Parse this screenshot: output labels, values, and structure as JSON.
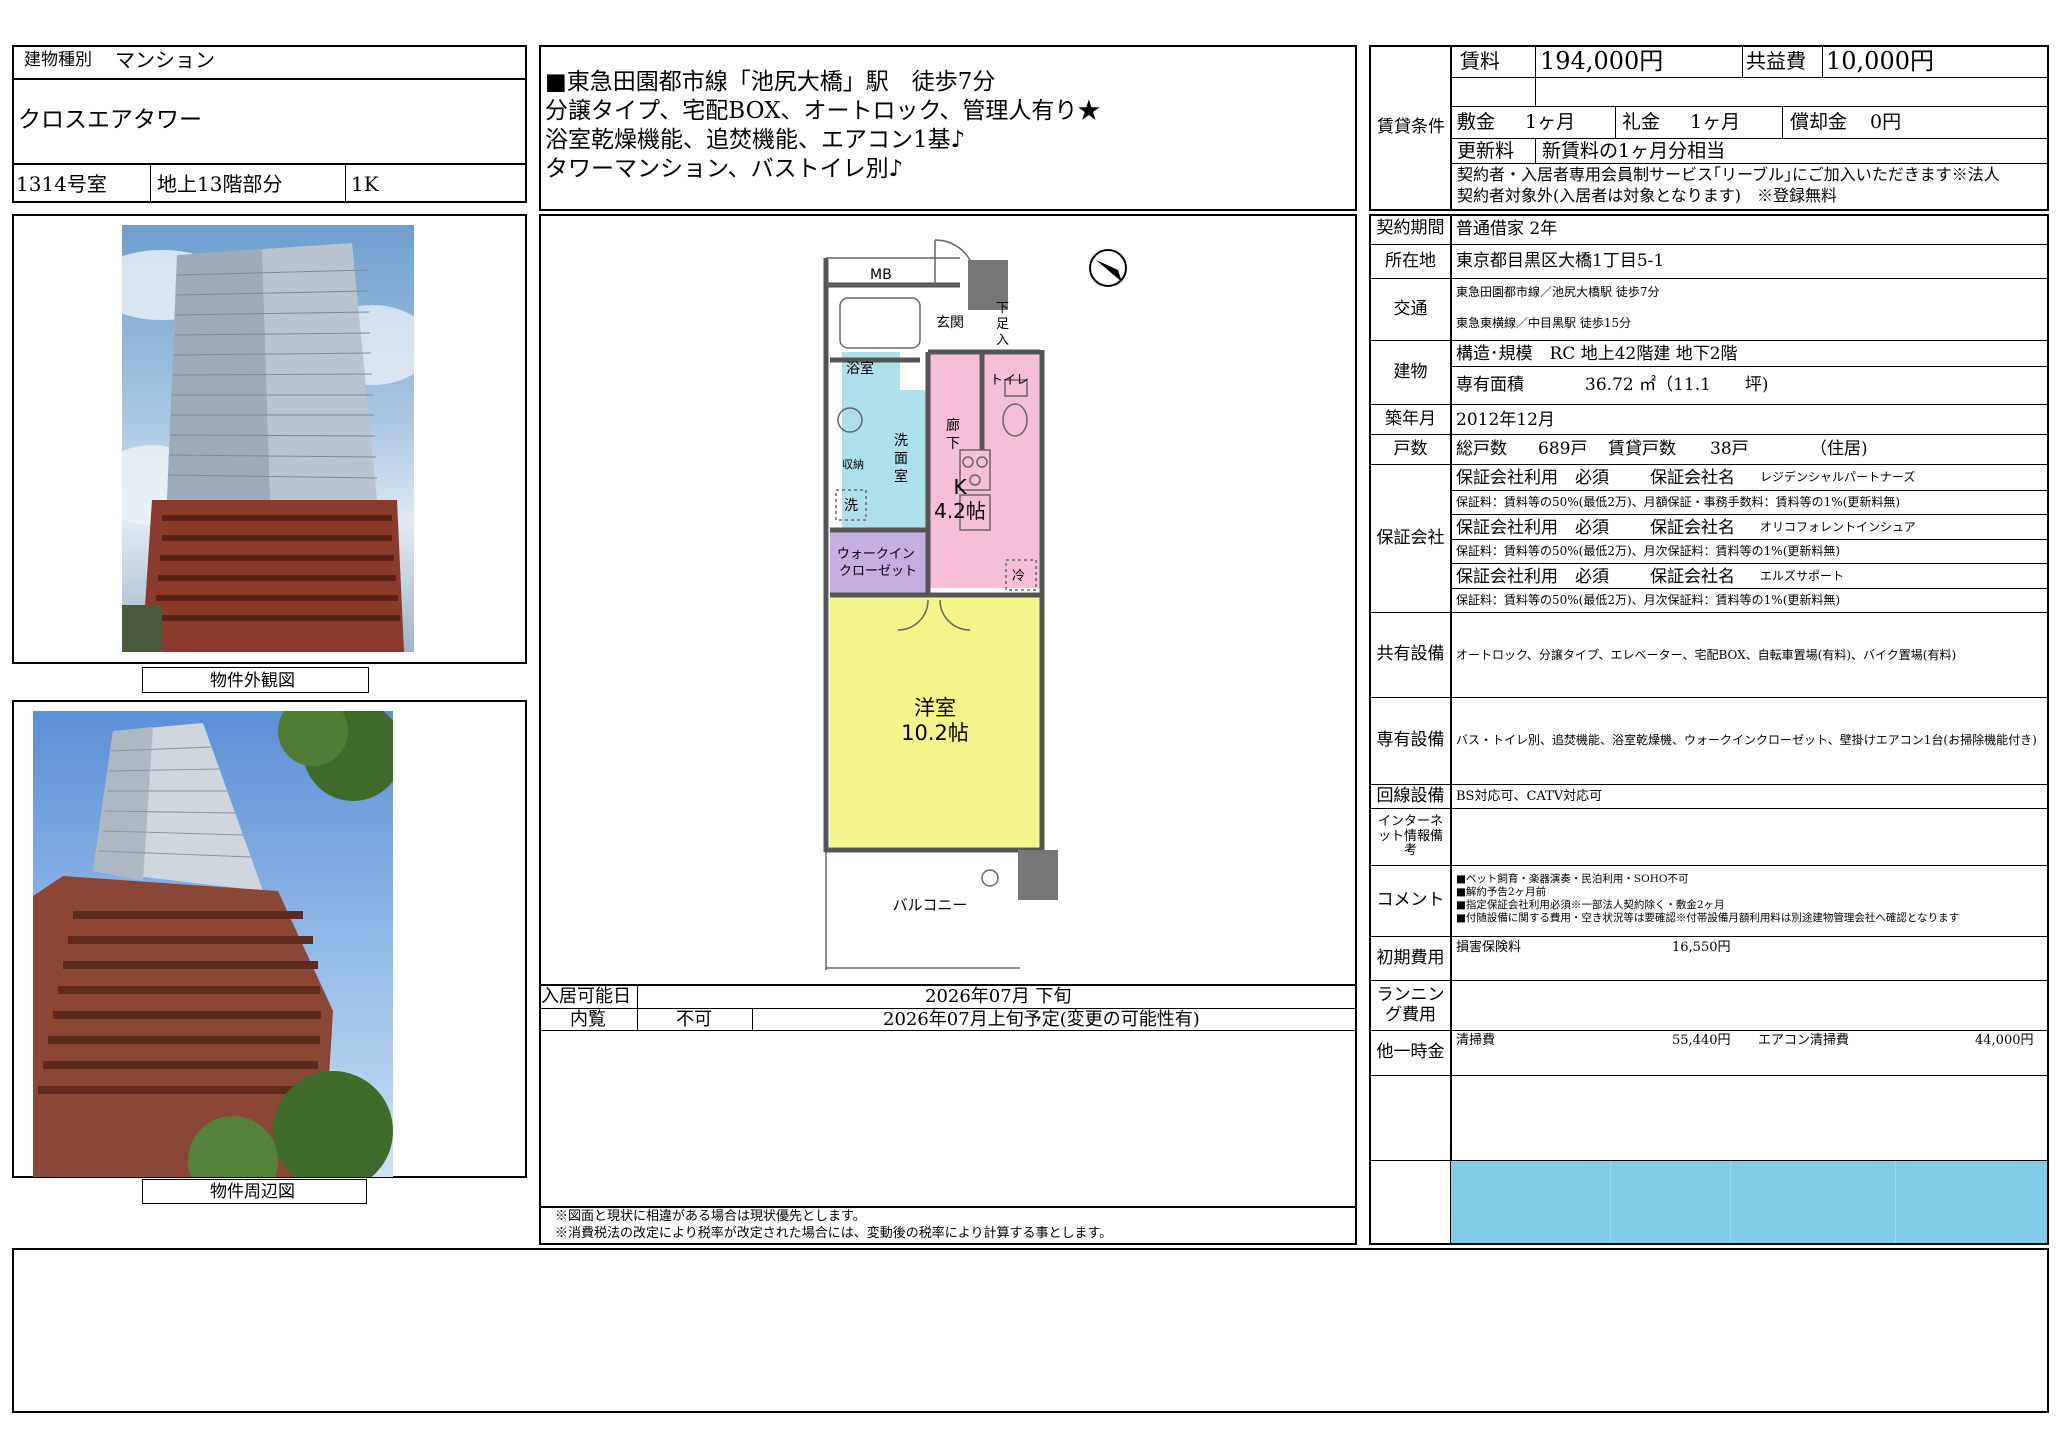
{
  "building": {
    "type_label": "建物種別",
    "type_value": "マンション",
    "name": "クロスエアタワー",
    "room": "1314号室",
    "floor": "地上13階部分",
    "layout": "1K"
  },
  "photos": {
    "exterior_caption": "物件外観図",
    "surroundings_caption": "物件周辺図"
  },
  "headline": [
    "■東急田園都市線「池尻大橋」駅　徒歩7分",
    "分譲タイプ、宅配BOX、オートロック、管理人有り★",
    "浴室乾燥機能、追焚機能、エアコン1基♪",
    "タワーマンション、バストイレ別♪"
  ],
  "floorplan": {
    "rooms": {
      "mb": "MB",
      "entrance": "玄関",
      "shoe_box": "下足入",
      "bath": "浴室",
      "toilet": "トイレ",
      "washroom": "洗面室",
      "corridor": "廊下",
      "storage": "収納",
      "washer": "洗",
      "kitchen": "K",
      "kitchen_size": "4.2帖",
      "wic": "ウォークイン\nクローゼット",
      "fridge": "冷",
      "western": "洋室",
      "western_size": "10.2帖",
      "balcony": "バルコニー"
    }
  },
  "availability": {
    "move_in_label": "入居可能日",
    "move_in_value": "2026年07月 下旬",
    "viewing_label": "内覧",
    "viewing_value": "不可",
    "viewing_note": "2026年07月上旬予定(変更の可能性有)"
  },
  "notes": [
    "※図面と現状に相違がある場合は現状優先とします。",
    "※消費税法の改定により税率が改定された場合には、変動後の税率により計算する事とします。"
  ],
  "conditions": {
    "section_label": "賃貸条件",
    "rent_label": "賃料",
    "rent_value": "194,000円",
    "common_label": "共益費",
    "common_value": "10,000円",
    "deposit_label": "敷金",
    "deposit_value": "1ヶ月",
    "key_money_label": "礼金",
    "key_money_value": "1ヶ月",
    "amort_label": "償却金",
    "amort_value": "0円",
    "renewal_label": "更新料",
    "renewal_value": "新賃料の1ヶ月分相当",
    "remark_1": "契約者・入居者専用会員制サービス｢リーブル｣にご加入いただきます※法人",
    "remark_2": "契約者対象外(入居者は対象となります)　※登録無料"
  },
  "details": {
    "contract_label": "契約期間",
    "contract_value": "普通借家 2年",
    "address_label": "所在地",
    "address_value": "東京都目黒区大橋1丁目5-1",
    "transport_label": "交通",
    "transport_1": "東急田園都市線／池尻大橋駅 徒歩7分",
    "transport_2": "東急東横線／中目黒駅 徒歩15分",
    "building_label": "建物",
    "structure": "構造･規模　RC 地上42階建 地下2階",
    "area_label": "専有面積",
    "area_value": "36.72 ㎡（11.1　　坪)",
    "built_label": "築年月",
    "built_value": "2012年12月",
    "units_label": "戸数",
    "units_total_label": "総戸数",
    "units_total": "689戸",
    "units_rent_label": "賃貸戸数",
    "units_rent": "38戸",
    "units_note": "（住居)",
    "guarantee_label": "保証会社",
    "guarantors": [
      {
        "use": "保証会社利用　必須",
        "name_label": "保証会社名",
        "name": "レジデンシャルパートナーズ",
        "fee": "保証料：賃料等の50%(最低2万)、月額保証・事務手数料：賃料等の1%(更新料無)"
      },
      {
        "use": "保証会社利用　必須",
        "name_label": "保証会社名",
        "name": "オリコフォレントインシュア",
        "fee": "保証料：賃料等の50%(最低2万)、月次保証料：賃料等の1%(更新料無)"
      },
      {
        "use": "保証会社利用　必須",
        "name_label": "保証会社名",
        "name": "エルズサポート",
        "fee": "保証料：賃料等の50%(最低2万)、月次保証料：賃料等の1%(更新料無)"
      }
    ],
    "shared_label": "共有設備",
    "shared_value": "オートロック、分譲タイプ、エレベーター、宅配BOX、自転車置場(有料)、バイク置場(有料)",
    "private_label": "専有設備",
    "private_value": "バス・トイレ別、追焚機能、浴室乾燥機、ウォークインクローゼット、壁掛けエアコン1台(お掃除機能付き)",
    "line_label": "回線設備",
    "line_value": "BS対応可、CATV対応可",
    "internet_label": "インターネット情報備考",
    "comment_label": "コメント",
    "comments": [
      "■ペット飼育・楽器演奏・民泊利用・SOHO不可",
      "■解約予告2ヶ月前",
      "■指定保証会社利用必須※一部法人契約除く・敷金2ヶ月",
      "■付随設備に関する費用・空き状況等は要確認※付帯設備月額利用料は別途建物管理会社へ確認となります"
    ],
    "initial_label": "初期費用",
    "initial_item": "損害保険料",
    "initial_value": "16,550円",
    "running_label": "ランニング費用",
    "other_label": "他一時金",
    "other_1_item": "清掃費",
    "other_1_value": "55,440円",
    "other_2_item": "エアコン清掃費",
    "other_2_value": "44,000円"
  },
  "colors": {
    "bath": "#aee0ea",
    "corridor": "#f6bfd9",
    "wic": "#c6aee0",
    "western": "#f3f58a",
    "footer_bar": "#7fcbe8"
  }
}
